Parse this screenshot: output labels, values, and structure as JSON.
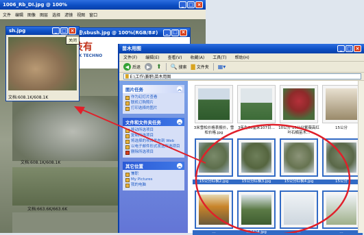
{
  "photo_window_back": {
    "title": "1006_Rb_DI.jpg @ 100%",
    "menu": [
      "文件",
      "编辑",
      "图像",
      "图层",
      "选择",
      "滤镜",
      "视图",
      "窗口"
    ]
  },
  "photo_window_small": {
    "title": "sh.jpg",
    "status": "文档:608.1K/608.1K"
  },
  "photo_status_1": "文档:608.1K/608.1K",
  "photo_status_2": "文档:663.6K/663.6K",
  "mid_window": {
    "title": "\\作\\兼职\\苗木用图\\sbush.jpg @ 100%(RGB/8#)",
    "banner_cn": "网络科技有",
    "banner_en": "S CHI NETWORK TECHNO"
  },
  "tooltip": "关闭",
  "explorer": {
    "title": "苗木用图",
    "menus": [
      "文件(F)",
      "编辑(E)",
      "查看(V)",
      "收藏(A)",
      "工具(T)",
      "帮助(H)"
    ],
    "toolbar": {
      "back": "后退",
      "search": "搜索",
      "folders": "文件夹"
    },
    "address": "E:\\工作\\兼职\\苗木用图",
    "panels": [
      {
        "title": "图片任务",
        "tasks": [
          "作为幻灯片查看",
          "联机订购照片",
          "打印选择的图片"
        ]
      },
      {
        "title": "文件和文件夹任务",
        "tasks": [
          "移动所选项目",
          "复制所选项目",
          "将选择的项目发布到 Web",
          "以电子邮件形式发送所选项目",
          "删除所选项目"
        ]
      },
      {
        "title": "其它位置",
        "tasks": [
          "兼职",
          "My Pictures",
          "我的电脑"
        ]
      }
    ],
    "captions_row1": [
      "3米雪松价格表报价，雪松价格.jpg",
      "3年生60厘米107日…",
      "10公分 15公分紫薇高红叶石楠苗木…",
      "15公分"
    ],
    "captions_row2": [
      "15公分红枫2.jpg",
      "15公分红枫3.jpg",
      "15公分红枫4.jpg",
      "15公分"
    ],
    "captions_row3": [
      "…",
      "…2424.jpg",
      "…",
      "…"
    ]
  },
  "colors": {
    "title_bar": "#0d4fc4",
    "task_pane": "#6f8fe0",
    "selection": "#316ac5",
    "annotation": "#e0202a"
  }
}
